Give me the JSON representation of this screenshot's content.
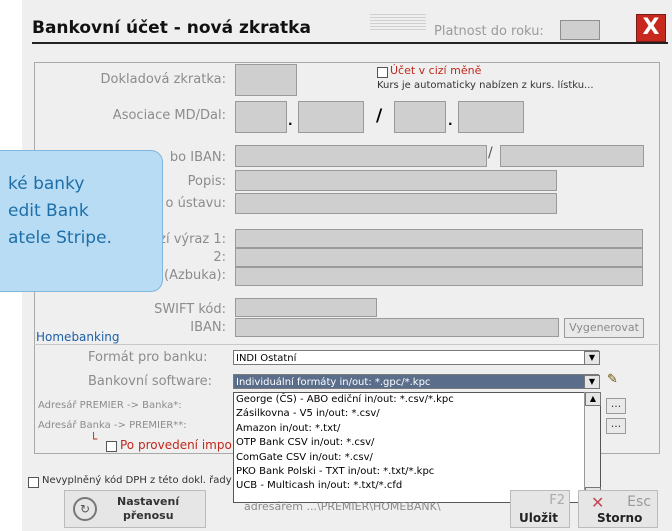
{
  "window": {
    "title": "Bankovní účet - nová zkratka",
    "platnost_label": "Platnost do roku:",
    "close_label": "X"
  },
  "form": {
    "dokladova_label": "Dokladová zkratka:",
    "cizi_mena_label": "Účet v cizí měně",
    "kurs_note": "Kurs je automaticky nabízen z kurs. lístku...",
    "asociace_label": "Asociace MD/Dal:",
    "asociace_dot1": ".",
    "asociace_slash": "/",
    "asociace_dot2": ".",
    "iban_label": "bo IBAN:",
    "iban_slash": "/",
    "popis_label": "Popis:",
    "ustavu_label": "o ústavu:",
    "vyraz1_label": "zí výraz 1:",
    "vyraz2_label": "2:",
    "azbuka_label": "(Azbuka):",
    "swift_label": "SWIFT kód:",
    "iban2_label": "IBAN:",
    "vygenerovat_label": "Vygenerovat"
  },
  "homebanking": {
    "legend": "Homebanking",
    "format_label": "Formát pro banku:",
    "format_value": "INDI Ostatní",
    "software_label": "Bankovní software:",
    "software_value": "Individuální formáty in/out: *.gpc/*.kpc",
    "adresar_banka_label": "Adresář PREMIER -> Banka*:",
    "adresar_premier_label": "Adresář Banka -> PREMIER**:",
    "provedeni_label": "Po provedení impo",
    "browse1": "...",
    "browse2": "..."
  },
  "dropdown_options": [
    "George (ČS)  - ABO ediční in/out: *.csv/*.kpc",
    "Zásilkovna - V5 in/out: *.csv/",
    "Amazon in/out: *.txt/",
    "OTP Bank CSV  in/out: *.csv/",
    "ComGate CSV  in/out: *.csv/",
    "PKO Bank Polski - TXT  in/out: *.txt/*.kpc",
    "UCB - Multicash  in/out: *.txt/*.cfd"
  ],
  "tooltip": {
    "lines": [
      "ké banky",
      "edit Bank",
      "atele Stripe."
    ]
  },
  "footer": {
    "dph_label": "Nevyplněný kód DPH z této dokl. řady",
    "nastaveni_line1": "Nastavení",
    "nastaveni_line2": "přenosu",
    "adresar_text": "adresářem ...\\PREMIER\\HOMEBANK\\",
    "f2_label": "F2",
    "ulozit_label": "Uložit",
    "esc_label": "Esc",
    "storno_label": "Storno"
  },
  "colors": {
    "close_red": "#c8291e",
    "tooltip_blue": "#b7dcf3",
    "link_blue": "#1e5fa8",
    "field_gray": "#cfcfcf"
  }
}
